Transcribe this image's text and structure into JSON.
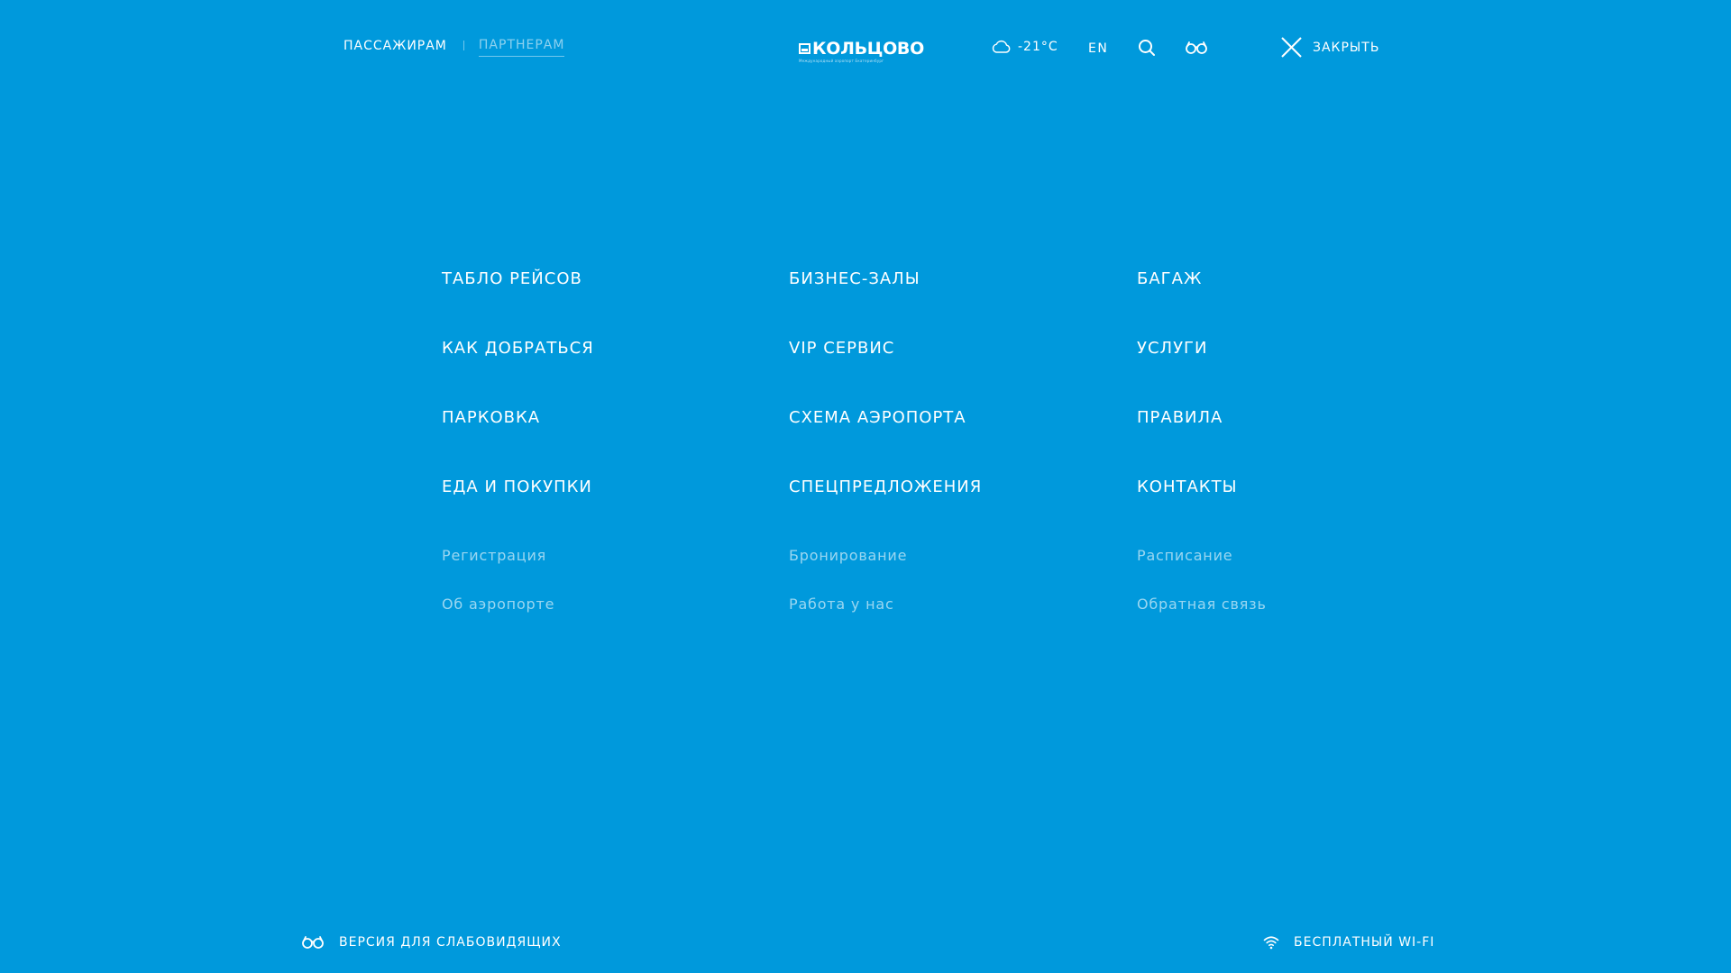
{
  "header": {
    "nav": [
      {
        "label": "ПАССАЖИРАМ",
        "active": true
      },
      {
        "label": "ПАРТНЕРАМ",
        "active": false
      }
    ],
    "logo_text": "КОЛЬЦОВО",
    "logo_subtext": "Международный аэропорт Екатеринбург",
    "weather": {
      "icon": "cloud-icon",
      "temperature": "-21°C"
    },
    "lang_label": "EN",
    "search_icon": "search-icon",
    "accessibility_icon": "glasses-icon",
    "close_label": "ЗАКРЫТЬ"
  },
  "menu": {
    "columns": [
      {
        "main": [
          "ТАБЛО РЕЙСОВ",
          "КАК ДОБРАТЬСЯ",
          "ПАРКОВКА",
          "ЕДА И ПОКУПКИ"
        ],
        "sub": [
          "Регистрация",
          "Об аэропорте"
        ]
      },
      {
        "main": [
          "БИЗНЕС-ЗАЛЫ",
          "VIP СЕРВИС",
          "СХЕМА АЭРОПОРТА",
          "СПЕЦПРЕДЛОЖЕНИЯ"
        ],
        "sub": [
          "Бронирование",
          "Работа у нас"
        ]
      },
      {
        "main": [
          "БАГАЖ",
          "УСЛУГИ",
          "ПРАВИЛА",
          "КОНТАКТЫ"
        ],
        "sub": [
          "Расписание",
          "Обратная связь"
        ]
      }
    ]
  },
  "footer": {
    "accessibility_label": "ВЕРСИЯ ДЛЯ СЛАБОВИДЯЩИХ",
    "wifi_label": "БЕСПЛАТНЫЙ WI-FI"
  },
  "colors": {
    "background": "#0099dc",
    "text": "#ffffff"
  }
}
